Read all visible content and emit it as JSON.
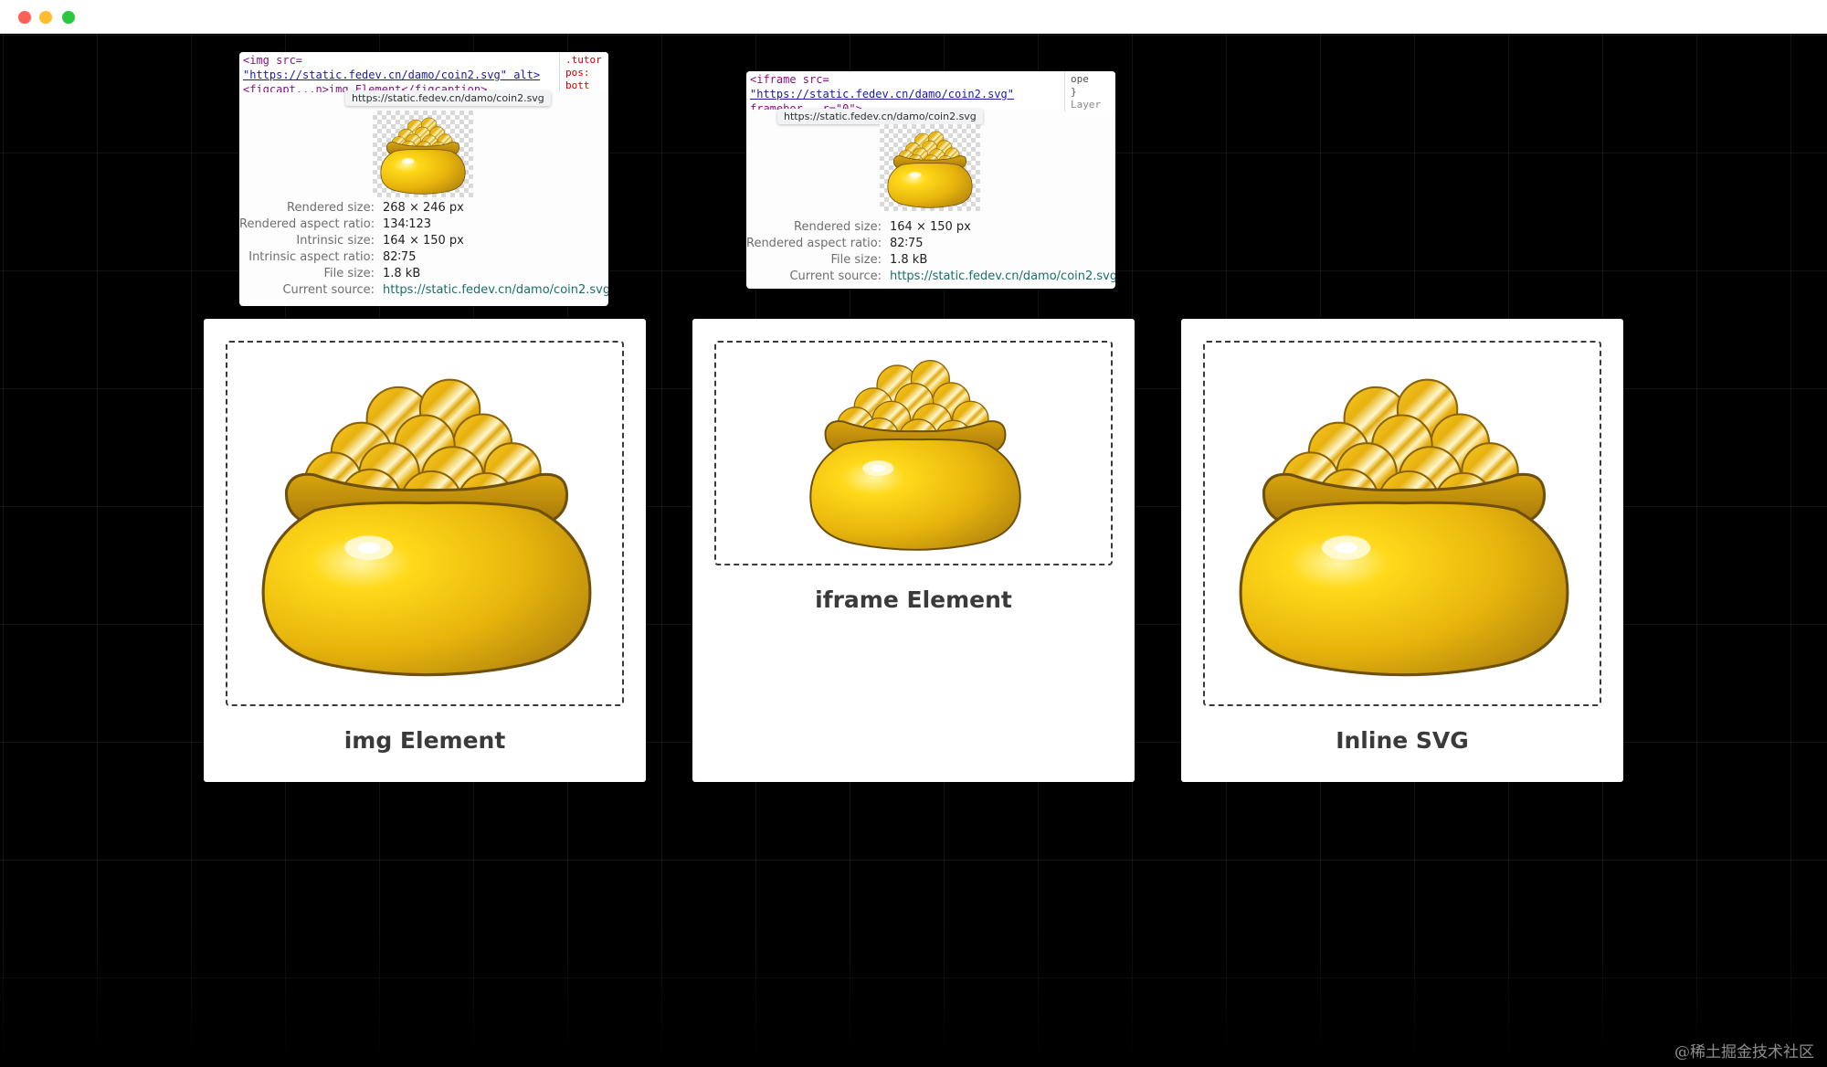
{
  "window": {
    "controls": [
      "close",
      "minimize",
      "maximize"
    ]
  },
  "img_tooltip": {
    "code_lines": [
      "<img src=",
      "\"https://static.fedev.cn/damo/coin2.svg\" alt>",
      "<figcapt...n>img Element</figcaption>"
    ],
    "side_lines": [
      ".tutor",
      "pos:",
      "bott"
    ],
    "url_chip": "https://static.fedev.cn/damo/coin2.svg",
    "rows": [
      {
        "label": "Rendered size:",
        "value": "268 × 246 px"
      },
      {
        "label": "Rendered aspect ratio:",
        "value": "134∶123"
      },
      {
        "label": "Intrinsic size:",
        "value": "164 × 150 px"
      },
      {
        "label": "Intrinsic aspect ratio:",
        "value": "82∶75"
      },
      {
        "label": "File size:",
        "value": "1.8 kB"
      },
      {
        "label": "Current source:",
        "value": "https://static.fedev.cn/damo/coin2.svg"
      }
    ]
  },
  "iframe_tooltip": {
    "code_lines": [
      "<iframe src=",
      "\"https://static.fedev.cn/damo/coin2.svg\"",
      "framebor...r=\"0\">"
    ],
    "side_lines": [
      "ope",
      "}",
      "Layer h"
    ],
    "url_chip": "https://static.fedev.cn/damo/coin2.svg",
    "rows": [
      {
        "label": "Rendered size:",
        "value": "164 × 150 px"
      },
      {
        "label": "Rendered aspect ratio:",
        "value": "82∶75"
      },
      {
        "label": "File size:",
        "value": "1.8 kB"
      },
      {
        "label": "Current source:",
        "value": "https://static.fedev.cn/damo/coin2.svg"
      }
    ]
  },
  "cards": [
    {
      "caption": "img Element",
      "image": "coin-pot-icon"
    },
    {
      "caption": "iframe Element",
      "image": "coin-pot-icon"
    },
    {
      "caption": "Inline SVG",
      "image": "coin-pot-icon"
    }
  ],
  "colors": {
    "gold_light": "#ffe055",
    "gold": "#e8b60a",
    "gold_dark": "#a27410",
    "outline": "#6e4f0c",
    "caption": "#3a3a3a"
  },
  "watermark": "@稀土掘金技术社区"
}
